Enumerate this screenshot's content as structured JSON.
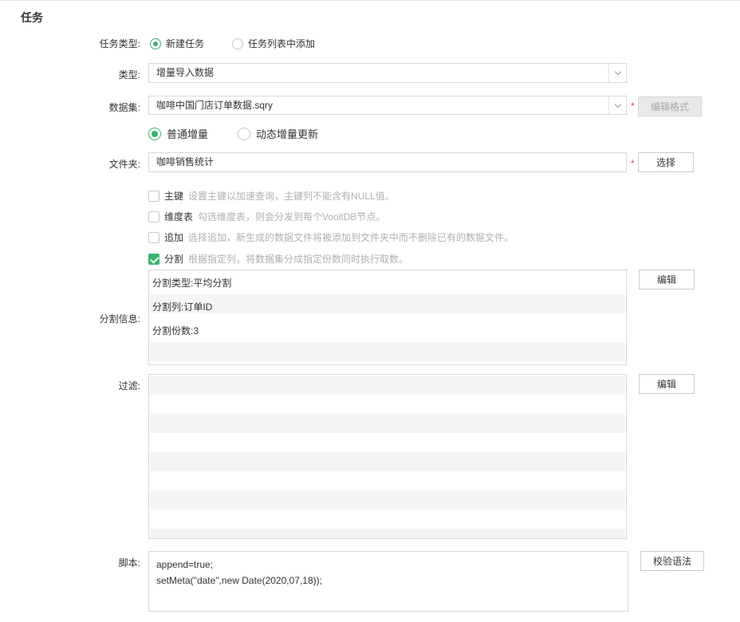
{
  "section": {
    "title": "任务"
  },
  "task_type": {
    "label": "任务类型:",
    "options": [
      {
        "label": "新建任务",
        "selected": true
      },
      {
        "label": "任务列表中添加",
        "selected": false
      }
    ]
  },
  "type": {
    "label": "类型:",
    "value": "增量导入数据",
    "icon": "chevron-down-icon"
  },
  "dataset": {
    "label": "数据集:",
    "value": "咖啡中国门店订单数据.sqry",
    "required_mark": "*",
    "edit_format_button": "编辑格式",
    "modes": [
      {
        "label": "普通增量",
        "selected": true
      },
      {
        "label": "动态增量更新",
        "selected": false
      }
    ]
  },
  "folder": {
    "label": "文件夹:",
    "value": "咖啡销售统计",
    "required_mark": "*",
    "choose_button": "选择"
  },
  "options": [
    {
      "name": "主键",
      "desc": "设置主键以加速查询，主键列不能含有NULL值。",
      "checked": false
    },
    {
      "name": "维度表",
      "desc": "勾选维度表，则会分发到每个VooltDB节点。",
      "checked": false
    },
    {
      "name": "追加",
      "desc": "选择追加，新生成的数据文件将被添加到文件夹中而不删除已有的数据文件。",
      "checked": false
    },
    {
      "name": "分割",
      "desc": "根据指定列，将数据集分成指定份数同时执行取数。",
      "checked": true
    }
  ],
  "split_info": {
    "label": "分割信息:",
    "lines": [
      "分割类型:平均分割",
      "分割列:订单ID",
      "分割份数:3"
    ],
    "edit_button": "编辑"
  },
  "filter": {
    "label": "过滤:",
    "edit_button": "编辑"
  },
  "script": {
    "label": "脚本:",
    "lines": [
      "append=true;",
      "setMeta(\"date\",new Date(2020,07,18));"
    ],
    "validate_button": "校验语法"
  },
  "colors": {
    "accent": "#3bb46e",
    "required": "#e5463a",
    "stripe": "#f5f5f5",
    "border": "#d9d9d9"
  }
}
